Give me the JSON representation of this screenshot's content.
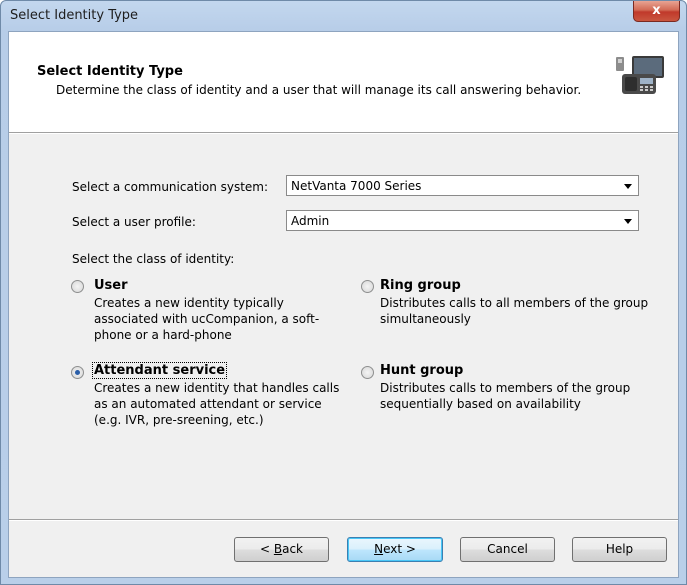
{
  "window": {
    "title": "Select Identity Type",
    "close_glyph": "x"
  },
  "header": {
    "title": "Select Identity Type",
    "description": "Determine the class of identity and a user that will manage its call answering behavior.",
    "icon": "phone-and-monitor-icon"
  },
  "form": {
    "system_label": "Select a communication system:",
    "system_value": "NetVanta 7000 Series",
    "profile_label": "Select a user profile:",
    "profile_value": "Admin",
    "class_label": "Select the class of identity:"
  },
  "options": {
    "user": {
      "title": "User",
      "desc": "Creates a new identity typically associated with ucCompanion, a soft-phone or a hard-phone",
      "selected": false
    },
    "ring_group": {
      "title": "Ring group",
      "desc": "Distributes calls to all members of the group simultaneously",
      "selected": false
    },
    "attendant": {
      "title": "Attendant service",
      "desc": "Creates a new identity that handles calls as an automated attendant or service (e.g. IVR, pre-sreening, etc.)",
      "selected": true
    },
    "hunt_group": {
      "title": "Hunt group",
      "desc": "Distributes calls to members of the group sequentially based on availability",
      "selected": false
    }
  },
  "buttons": {
    "back_prefix": "< ",
    "back_key": "B",
    "back_rest": "ack",
    "next_key": "N",
    "next_rest": "ext >",
    "cancel": "Cancel",
    "help": "Help"
  },
  "colors": {
    "accent": "#2a5ea8",
    "close": "#c0392b",
    "titlebar": "#b9cfe9"
  }
}
